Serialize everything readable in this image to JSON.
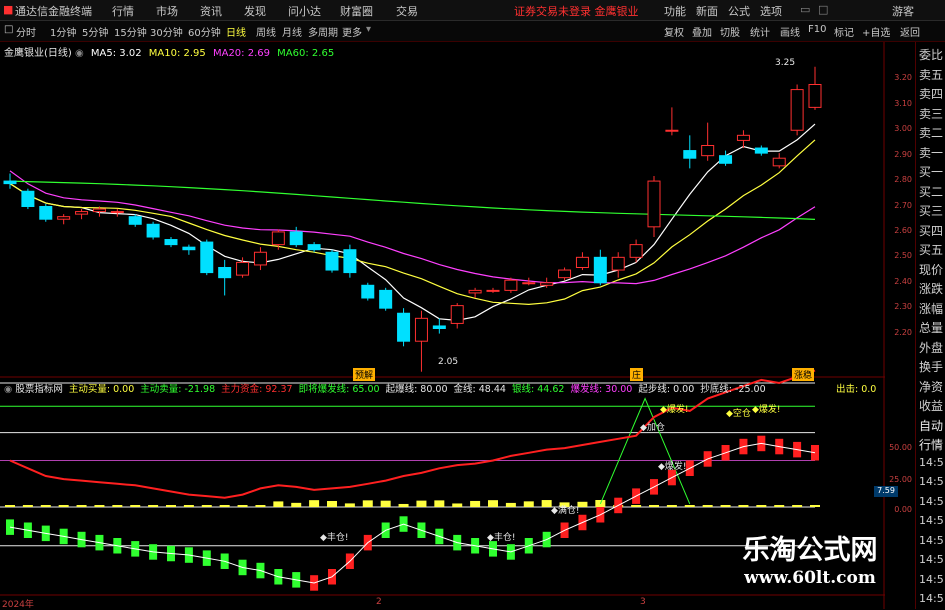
{
  "app": {
    "title": "通达信金融终端",
    "menu": [
      "行情",
      "市场",
      "资讯",
      "发现",
      "问小达",
      "财富圈",
      "交易"
    ],
    "notice": "证券交易未登录 金鹰银业",
    "right_menu": [
      "功能",
      "新面",
      "公式",
      "选项"
    ],
    "right_extra": "游客"
  },
  "toolbar": {
    "periods": [
      "分时",
      "1分钟",
      "5分钟",
      "15分钟",
      "30分钟",
      "60分钟",
      "日线",
      "周线",
      "月线",
      "多周期",
      "更多"
    ],
    "active_period": "日线",
    "right_buttons": [
      "复权",
      "叠加",
      "切股",
      "统计",
      "画线",
      "F10",
      "标记",
      "+自选",
      "返回"
    ]
  },
  "stock": {
    "name": "金鹰银业(日线)",
    "ma": [
      {
        "label": "MA5: 3.02",
        "color": "#ffffff"
      },
      {
        "label": "MA10: 2.95",
        "color": "#ffff40"
      },
      {
        "label": "MA20: 2.69",
        "color": "#ff40ff"
      },
      {
        "label": "MA60: 2.65",
        "color": "#30ff30"
      }
    ],
    "high_label": "3.25",
    "low_label": "2.05",
    "price_axis": [
      "3.20",
      "3.10",
      "3.00",
      "2.90",
      "2.80",
      "2.70",
      "2.60",
      "2.50",
      "2.40",
      "2.30",
      "2.20"
    ],
    "badges": [
      "预解",
      "庄",
      "涨稳"
    ]
  },
  "indicator": {
    "name": "股票指标网",
    "items": [
      {
        "label": "主动买量: 0.00",
        "color": "#ffff40"
      },
      {
        "label": "主动卖量: -21.98",
        "color": "#30ff30"
      },
      {
        "label": "主力资金: 92.37",
        "color": "#ff3030"
      },
      {
        "label": "即将爆发线: 65.00",
        "color": "#30ff30"
      },
      {
        "label": "起爆线: 80.00",
        "color": "#e8e8e8"
      },
      {
        "label": "金线: 48.44",
        "color": "#e8e8e8"
      },
      {
        "label": "银线: 44.62",
        "color": "#30ff30"
      },
      {
        "label": "爆发线: 30.00",
        "color": "#ff40ff"
      },
      {
        "label": "起步线: 0.00",
        "color": "#e8e8e8"
      },
      {
        "label": "抄底线: -25.00",
        "color": "#e8e8e8"
      }
    ],
    "out_label": "出击: 0.0",
    "axis": [
      "50.00",
      "25.00",
      "0.00"
    ],
    "value_box": "7.59",
    "annotations": [
      "爆发!",
      "空仓",
      "爆发!",
      "加仓",
      "爆发!",
      "满仓!",
      "丰仓!",
      "丰仓!"
    ]
  },
  "dates": [
    "2024年",
    "2",
    "3"
  ],
  "side_panel": [
    "委比",
    "卖五",
    "卖四",
    "卖三",
    "卖二",
    "卖一",
    "买一",
    "买二",
    "买三",
    "买四",
    "买五",
    "现价",
    "涨跌",
    "涨幅",
    "总量",
    "外盘",
    "换手",
    "净资",
    "收益",
    "自动",
    "行情",
    "14:5",
    "14:5",
    "14:5",
    "14:5",
    "14:5",
    "14:5",
    "14:5",
    "14:5"
  ],
  "watermark": {
    "title": "乐淘公式网",
    "url": "www.60lt.com"
  },
  "chart_data": {
    "type": "candlestick",
    "ylim": [
      2.1,
      3.3
    ],
    "candles": [
      [
        2.8,
        2.79,
        2.83,
        2.77
      ],
      [
        2.76,
        2.7,
        2.77,
        2.69
      ],
      [
        2.7,
        2.65,
        2.71,
        2.64
      ],
      [
        2.65,
        2.66,
        2.67,
        2.63
      ],
      [
        2.67,
        2.68,
        2.69,
        2.65
      ],
      [
        2.68,
        2.69,
        2.7,
        2.66
      ],
      [
        2.68,
        2.68,
        2.69,
        2.66
      ],
      [
        2.66,
        2.63,
        2.67,
        2.62
      ],
      [
        2.63,
        2.58,
        2.64,
        2.57
      ],
      [
        2.57,
        2.55,
        2.58,
        2.54
      ],
      [
        2.54,
        2.53,
        2.55,
        2.51
      ],
      [
        2.56,
        2.44,
        2.57,
        2.43
      ],
      [
        2.46,
        2.42,
        2.49,
        2.35
      ],
      [
        2.43,
        2.48,
        2.5,
        2.42
      ],
      [
        2.47,
        2.52,
        2.54,
        2.45
      ],
      [
        2.55,
        2.6,
        2.61,
        2.53
      ],
      [
        2.6,
        2.55,
        2.62,
        2.54
      ],
      [
        2.55,
        2.53,
        2.56,
        2.52
      ],
      [
        2.52,
        2.45,
        2.53,
        2.44
      ],
      [
        2.53,
        2.44,
        2.55,
        2.42
      ],
      [
        2.39,
        2.34,
        2.4,
        2.33
      ],
      [
        2.37,
        2.3,
        2.38,
        2.29
      ],
      [
        2.28,
        2.17,
        2.3,
        2.15
      ],
      [
        2.17,
        2.26,
        2.29,
        2.05
      ],
      [
        2.23,
        2.22,
        2.26,
        2.2
      ],
      [
        2.24,
        2.31,
        2.32,
        2.22
      ],
      [
        2.36,
        2.37,
        2.38,
        2.34
      ],
      [
        2.37,
        2.37,
        2.38,
        2.36
      ],
      [
        2.37,
        2.41,
        2.42,
        2.36
      ],
      [
        2.4,
        2.4,
        2.42,
        2.39
      ],
      [
        2.39,
        2.4,
        2.42,
        2.38
      ],
      [
        2.42,
        2.45,
        2.46,
        2.41
      ],
      [
        2.46,
        2.5,
        2.52,
        2.45
      ],
      [
        2.5,
        2.4,
        2.53,
        2.39
      ],
      [
        2.45,
        2.5,
        2.52,
        2.42
      ],
      [
        2.5,
        2.55,
        2.57,
        2.48
      ],
      [
        2.62,
        2.8,
        2.82,
        2.58
      ],
      [
        3.0,
        3.0,
        3.09,
        2.98
      ],
      [
        2.92,
        2.89,
        2.98,
        2.85
      ],
      [
        2.9,
        2.94,
        3.03,
        2.88
      ],
      [
        2.9,
        2.87,
        2.92,
        2.86
      ],
      [
        2.96,
        2.98,
        3.0,
        2.93
      ],
      [
        2.93,
        2.91,
        2.94,
        2.9
      ],
      [
        2.86,
        2.89,
        2.91,
        2.85
      ],
      [
        3.0,
        3.16,
        3.18,
        2.98
      ],
      [
        3.09,
        3.18,
        3.25,
        3.08
      ]
    ]
  }
}
